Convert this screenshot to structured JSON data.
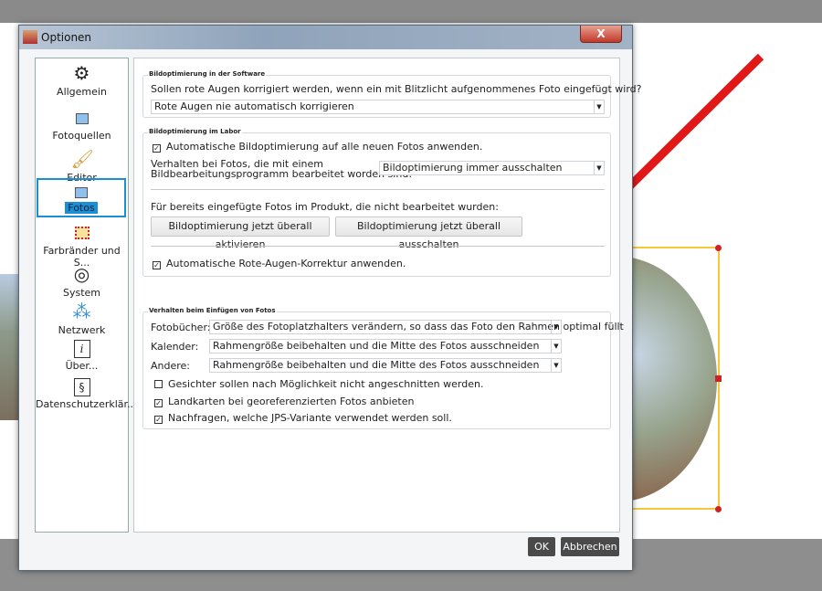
{
  "dialog": {
    "title": "Optionen",
    "close": "X"
  },
  "sidebar": {
    "items": [
      {
        "label": "Allgemein",
        "icon": "gear-icon"
      },
      {
        "label": "Fotoquellen",
        "icon": "photo-icon"
      },
      {
        "label": "Editor",
        "icon": "brush-icon"
      },
      {
        "label": "Fotos",
        "icon": "photo-icon",
        "selected": true
      },
      {
        "label": "Farbränder und S...",
        "icon": "frame-icon"
      },
      {
        "label": "System",
        "icon": "system-icon"
      },
      {
        "label": "Netzwerk",
        "icon": "network-icon"
      },
      {
        "label": "Über...",
        "icon": "info-icon"
      },
      {
        "label": "Datenschutzerklär...",
        "icon": "paragraph-icon"
      }
    ]
  },
  "software": {
    "title": "Bildoptimierung in der Software",
    "question": "Sollen rote Augen korrigiert werden, wenn ein mit Blitzlicht aufgenommenes Foto eingefügt wird?",
    "select": "Rote Augen nie automatisch korrigieren"
  },
  "labor": {
    "title": "Bildoptimierung im Labor",
    "auto_opt": "Automatische Bildoptimierung auf alle neuen Fotos anwenden.",
    "edited_label_1": "Verhalten bei Fotos, die mit einem",
    "edited_label_2": "Bildbearbeitungsprogramm bearbeitet worden sind:",
    "edited_select": "Bildoptimierung immer ausschalten",
    "existing_label": "Für bereits eingefügte Fotos im Produkt, die nicht bearbeitet wurden:",
    "activate_btn": "Bildoptimierung jetzt überall aktivieren",
    "deactivate_btn": "Bildoptimierung jetzt überall ausschalten",
    "redeye": "Automatische Rote-Augen-Korrektur anwenden."
  },
  "insert": {
    "title": "Verhalten beim Einfügen von Fotos",
    "rows": [
      {
        "label": "Fotobücher:",
        "value": "Größe des Fotoplatzhalters verändern, so dass das Foto den Rahmen optimal füllt"
      },
      {
        "label": "Kalender:",
        "value": "Rahmengröße beibehalten und die Mitte des Fotos ausschneiden"
      },
      {
        "label": "Andere:",
        "value": "Rahmengröße beibehalten und die Mitte des Fotos ausschneiden"
      }
    ],
    "checks": [
      {
        "label": "Gesichter sollen nach Möglichkeit nicht angeschnitten werden.",
        "checked": false
      },
      {
        "label": "Landkarten bei georeferenzierten Fotos anbieten",
        "checked": true
      },
      {
        "label": "Nachfragen, welche JPS-Variante verwendet werden soll.",
        "checked": true
      }
    ]
  },
  "footer": {
    "ok": "OK",
    "cancel": "Abbrechen"
  },
  "colors": {
    "accent": "#1a8fd6",
    "arrow": "#e01818",
    "frame": "#f3c93b"
  }
}
